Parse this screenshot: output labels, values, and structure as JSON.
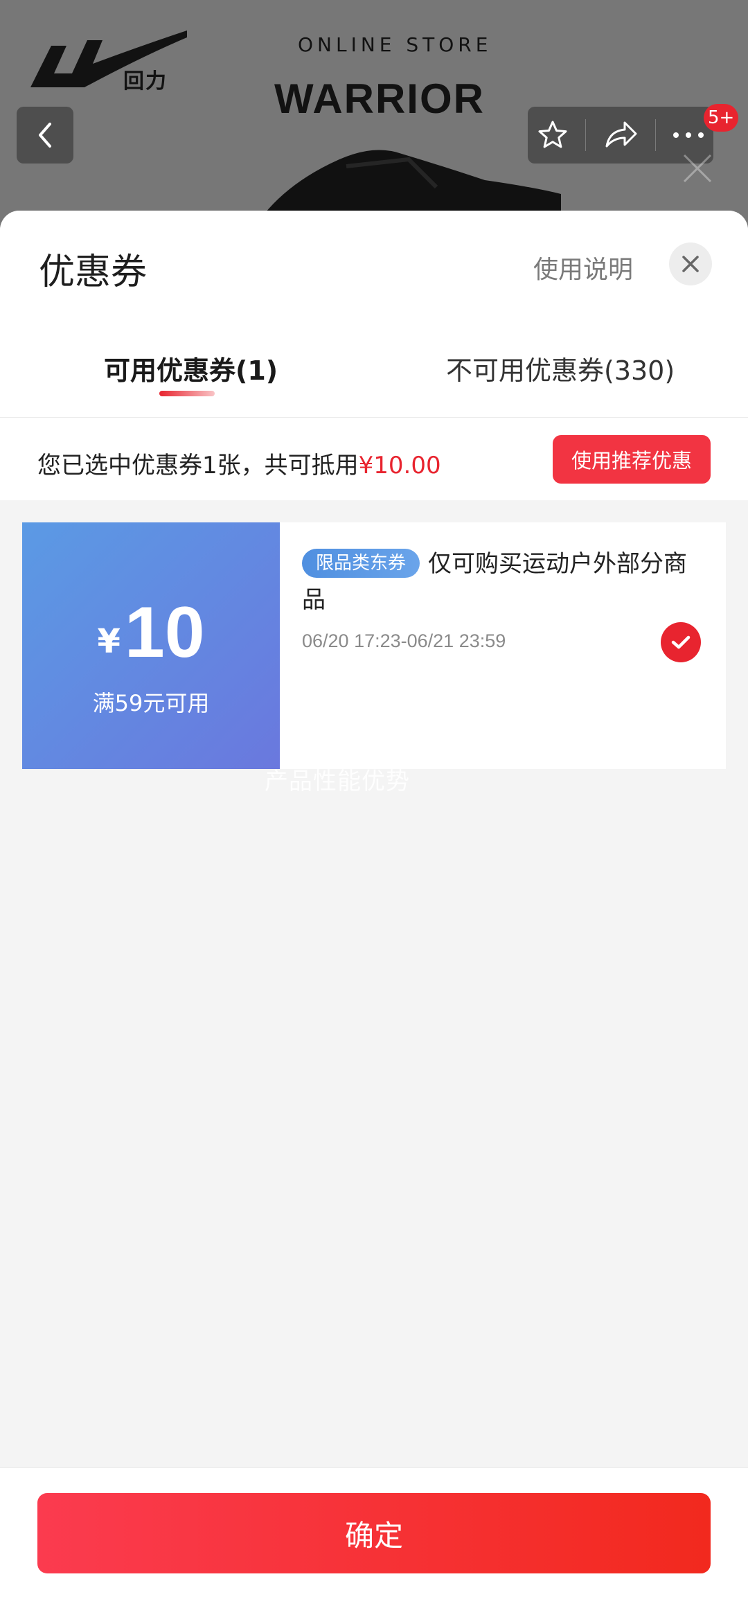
{
  "background_page": {
    "brand_name": "回力",
    "store_subtitle": "ONLINE STORE",
    "store_name": "WARRIOR",
    "notification_badge": "5+",
    "icons": [
      "back-icon",
      "star-icon",
      "share-icon",
      "more-icon",
      "close-icon"
    ]
  },
  "sheet": {
    "title": "优惠券",
    "help_link": "使用说明",
    "tabs": [
      {
        "label": "可用优惠券(1)",
        "active": true
      },
      {
        "label": "不可用优惠券(330)",
        "active": false
      }
    ],
    "summary": {
      "text": "您已选中优惠券1张，共可抵用",
      "amount": "¥10.00"
    },
    "recommend_button": "使用推荐优惠",
    "coupons": [
      {
        "currency": "¥",
        "value": "10",
        "condition": "满59元可用",
        "tag": "限品类东券",
        "description": "仅可购买运动户外部分商品",
        "validity": "06/20 17:23-06/21 23:59",
        "selected": true
      }
    ],
    "watermark": "产品性能优势",
    "confirm_button": "确定"
  },
  "colors": {
    "accent_red": "#e8242f",
    "coupon_blue_start": "#5b9ae4",
    "coupon_blue_end": "#6a78de"
  }
}
